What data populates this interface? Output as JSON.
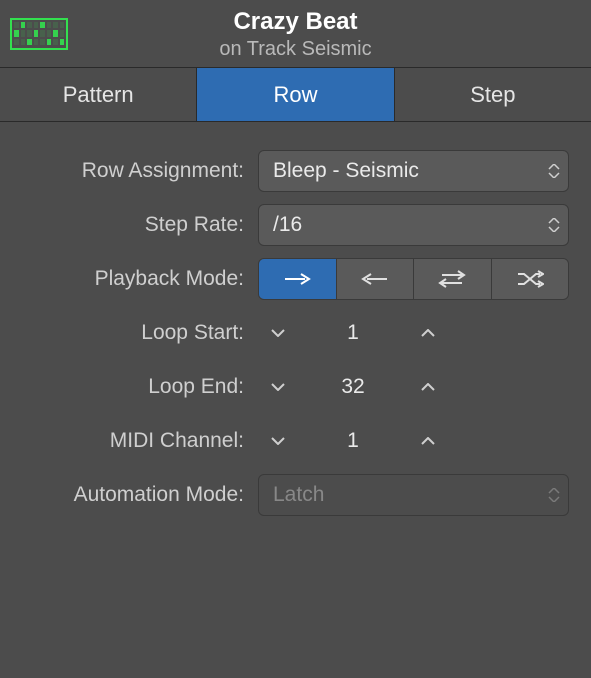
{
  "header": {
    "title": "Crazy Beat",
    "subtitle": "on Track Seismic"
  },
  "tabs": {
    "items": [
      {
        "label": "Pattern",
        "active": false
      },
      {
        "label": "Row",
        "active": true
      },
      {
        "label": "Step",
        "active": false
      }
    ]
  },
  "labels": {
    "row_assignment": "Row Assignment:",
    "step_rate": "Step Rate:",
    "playback_mode": "Playback Mode:",
    "loop_start": "Loop Start:",
    "loop_end": "Loop End:",
    "midi_channel": "MIDI Channel:",
    "automation_mode": "Automation Mode:"
  },
  "values": {
    "row_assignment": "Bleep - Seismic",
    "step_rate": "/16",
    "loop_start": "1",
    "loop_end": "32",
    "midi_channel": "1",
    "automation_mode": "Latch"
  },
  "playback_mode_options": [
    "forward",
    "backward",
    "pendulum",
    "random"
  ],
  "playback_mode_selected_index": 0
}
